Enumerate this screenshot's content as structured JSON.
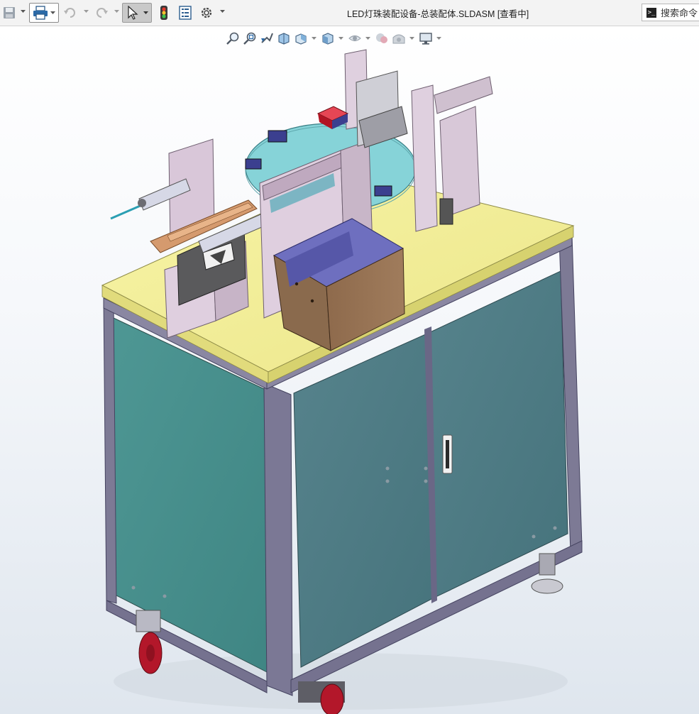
{
  "window": {
    "title": "LED灯珠装配设备-总装配体.SLDASM [查看中]"
  },
  "search": {
    "label": "搜索命令"
  },
  "quick_access": [
    {
      "name": "save",
      "icon": "save-icon"
    },
    {
      "name": "print",
      "icon": "print-icon"
    },
    {
      "name": "undo",
      "icon": "undo-icon"
    },
    {
      "name": "redo",
      "icon": "redo-icon"
    },
    {
      "name": "select",
      "icon": "cursor-icon"
    },
    {
      "name": "rebuild",
      "icon": "traffic-light-icon"
    },
    {
      "name": "file-properties",
      "icon": "file-properties-icon"
    },
    {
      "name": "options",
      "icon": "gear-icon"
    }
  ],
  "heads_up_toolbar": [
    {
      "name": "zoom-to-fit",
      "icon": "zoom-fit-icon"
    },
    {
      "name": "zoom-to-area",
      "icon": "zoom-area-icon"
    },
    {
      "name": "previous-view",
      "icon": "previous-view-icon"
    },
    {
      "name": "section-view",
      "icon": "section-view-icon"
    },
    {
      "name": "view-orientation",
      "icon": "view-orientation-icon"
    },
    {
      "name": "display-style",
      "icon": "display-style-icon"
    },
    {
      "name": "hide-show-items",
      "icon": "hide-show-icon"
    },
    {
      "name": "edit-appearance",
      "icon": "appearance-icon"
    },
    {
      "name": "apply-scene",
      "icon": "scene-icon"
    },
    {
      "name": "view-settings",
      "icon": "monitor-icon"
    }
  ],
  "colors": {
    "tabletop": "#f3ef93",
    "cabinet_panel": "#4b8f8d",
    "door_panel": "#4f7f86",
    "frame": "#7d7a95",
    "turntable": "#86d3d8",
    "bracket": "#d8c6d8",
    "hopper": "#8c6a4e",
    "hopper_inner": "#6e6fbf",
    "wheel": "#b3172a",
    "wood_rail": "#d59a6e",
    "red_block": "#d61a2a"
  }
}
